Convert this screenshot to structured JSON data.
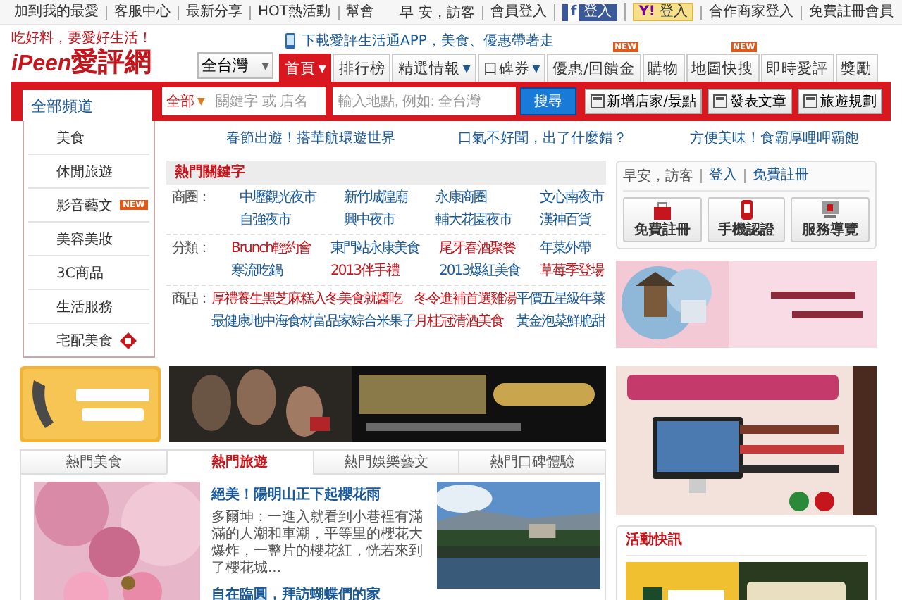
{
  "top_bar": {
    "links": [
      "加到我的最愛",
      "客服中心",
      "最新分享",
      "HOT熱活動",
      "幫會"
    ],
    "greeting": "早 安，訪客",
    "member_login": "會員登入",
    "facebook_login": {
      "logo": "f",
      "label": "登入"
    },
    "yahoo_login": {
      "logo": "Y!",
      "label": "登入"
    },
    "partner_login": "合作商家登入",
    "register": "免費註冊會員"
  },
  "logo": {
    "slogan": "吃好料，要愛好生活！",
    "brand": "iPeen",
    "name": "愛評網"
  },
  "app_promo": "下載愛評生活通APP，美食、優惠帶著走",
  "region_select": {
    "value": "全台灣",
    "caret": "▼"
  },
  "nav": [
    {
      "label": "首頁",
      "caret": "▼",
      "selected": true
    },
    {
      "label": "排行榜",
      "selected": false
    },
    {
      "label": "精選情報",
      "caret": "▼",
      "selected": false
    },
    {
      "label": "口碑券",
      "caret": "▼",
      "selected": false
    },
    {
      "label": "優惠/回饋金",
      "badge": "NEW",
      "selected": false
    },
    {
      "label": "購物",
      "selected": false
    },
    {
      "label": "地圖快搜",
      "badge": "NEW",
      "selected": false
    },
    {
      "label": "即時愛評",
      "selected": false
    },
    {
      "label": "獎勵",
      "selected": false
    }
  ],
  "search_bar": {
    "channel_tab": "全部頻道",
    "category": "全部",
    "category_caret": "▼",
    "keyword_placeholder": "關鍵字 或 店名",
    "location_placeholder": "輸入地點, 例如: 全台灣",
    "search_button": "搜尋",
    "actions": [
      "新增店家/景點",
      "發表文章",
      "旅遊規劃"
    ]
  },
  "channel_menu": [
    {
      "label": "美食"
    },
    {
      "label": "休閒旅遊"
    },
    {
      "label": "影音藝文",
      "badge": "NEW"
    },
    {
      "label": "美容美妝"
    },
    {
      "label": "3C商品"
    },
    {
      "label": "生活服務"
    },
    {
      "label": "宅配美食",
      "kind": "icon"
    }
  ],
  "headlines": [
    "春節出遊！搭華航環遊世界",
    "口氣不好聞，出了什麼錯？",
    "方便美味！食霸厚哩呷霸飽"
  ],
  "hot_keywords": {
    "title": "熱門關鍵字",
    "groups": [
      {
        "label": "商圈：",
        "items": [
          {
            "text": "中壢觀光夜市",
            "color": "#1a5a9a"
          },
          {
            "text": "新竹城隍廟",
            "color": "#1a5a9a"
          },
          {
            "text": "永康商圈",
            "color": "#1a5a9a"
          },
          {
            "text": "文心南夜市",
            "color": "#1a5a9a"
          },
          {
            "text": "自強夜市",
            "color": "#1a5a9a"
          },
          {
            "text": "興中夜市",
            "color": "#1a5a9a"
          },
          {
            "text": "輔大花園夜市",
            "color": "#1a5a9a"
          },
          {
            "text": "漢神百貨",
            "color": "#1a5a9a"
          }
        ]
      },
      {
        "label": "分類：",
        "items": [
          {
            "text": "Brunch輕約會",
            "color": "#c4161c"
          },
          {
            "text": "東門站永康美食",
            "color": "#1a5a9a"
          },
          {
            "text": "尾牙春酒聚餐",
            "color": "#c4161c"
          },
          {
            "text": "年菜外帶",
            "color": "#1a5a9a"
          },
          {
            "text": "寒流吃鍋",
            "color": "#1a5a9a"
          },
          {
            "text": "2013伴手禮",
            "color": "#c4161c"
          },
          {
            "text": "2013爆紅美食",
            "color": "#1a5a9a"
          },
          {
            "text": "草莓季登場",
            "color": "#c4161c"
          }
        ]
      },
      {
        "label": "商品：",
        "items": [
          {
            "text": "厚禮養生黑芝麻糕",
            "color": "#c4161c"
          },
          {
            "text": "入冬美食就醬吃",
            "color": "#c4161c"
          },
          {
            "text": "冬令進補首選雞湯",
            "color": "#c4161c"
          },
          {
            "text": "平價五星級年菜",
            "color": "#1a5a9a"
          },
          {
            "text": "最健康地中海食材",
            "color": "#1a5a9a"
          },
          {
            "text": "富品家綜合米果子",
            "color": "#1a5a9a"
          },
          {
            "text": "月桂冠清酒美食",
            "color": "#c4161c"
          },
          {
            "text": "黃金泡菜鮮脆甜",
            "color": "#1a5a9a"
          }
        ]
      }
    ]
  },
  "member_box": {
    "greeting": "早安，訪客",
    "login": "登入",
    "register": "免費註冊",
    "buttons": [
      {
        "label": "免費註冊",
        "kind": "bag"
      },
      {
        "label": "手機認證",
        "kind": "phone"
      },
      {
        "label": "服務導覽",
        "kind": "computer"
      }
    ]
  },
  "content_tabs": [
    {
      "label": "熱門美食",
      "selected": false
    },
    {
      "label": "熱門旅遊",
      "selected": true
    },
    {
      "label": "熱門娛樂藝文",
      "selected": false
    },
    {
      "label": "熱門口碑體驗",
      "selected": false
    }
  ],
  "articles": [
    {
      "title": "絕美！陽明山正下起櫻花雨",
      "summary": "多爾坤：一進入就看到小巷裡有滿滿的人潮和車潮，平等里的櫻花大爆炸，一整片的櫻花紅，恍若來到了櫻花城..."
    },
    {
      "title": "自在臨圓，拜訪蝴蝶們的家"
    }
  ],
  "events_panel": {
    "title": "活動快訊"
  }
}
